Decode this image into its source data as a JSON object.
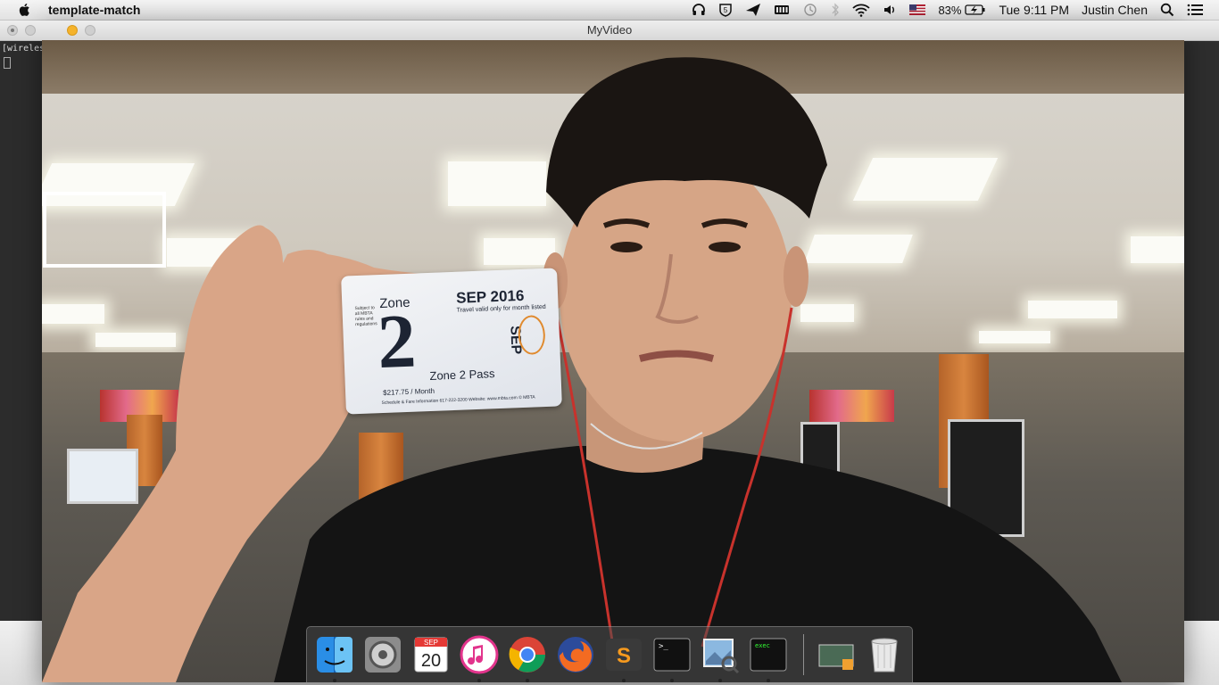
{
  "menubar": {
    "app_name": "template-match",
    "battery_percent": "83%",
    "clock": "Tue 9:11 PM",
    "user": "Justin Chen",
    "icons": [
      "apple-icon",
      "headphones-icon",
      "shield-icon",
      "send-icon",
      "keyboard-icon",
      "time-machine-icon",
      "bluetooth-icon",
      "wifi-icon",
      "volume-icon",
      "flag-icon",
      "battery-icon",
      "search-icon",
      "list-icon"
    ]
  },
  "terminal": {
    "visible_text": "[wireles",
    "right_bracket": "]"
  },
  "window": {
    "title": "MyVideo"
  },
  "pass": {
    "zone_word": "Zone",
    "zone_number": "2",
    "month": "SEP 2016",
    "validity": "Travel valid only for month listed",
    "vertical_month": "SEP",
    "name": "Zone 2 Pass",
    "price": "$217.75 / Month",
    "footer": "Schedule & Fare Information 617-222-3200 Website: www.mbta.com © MBTA"
  },
  "dock": {
    "items": [
      {
        "name": "Finder",
        "icon": "finder-icon",
        "running": true
      },
      {
        "name": "System Preferences",
        "icon": "system-preferences-icon",
        "running": false
      },
      {
        "name": "Calendar",
        "icon": "calendar-icon",
        "running": false,
        "month": "SEP",
        "day": "20"
      },
      {
        "name": "iTunes",
        "icon": "itunes-icon",
        "running": true
      },
      {
        "name": "Google Chrome",
        "icon": "chrome-icon",
        "running": true
      },
      {
        "name": "Firefox",
        "icon": "firefox-icon",
        "running": false
      },
      {
        "name": "Sublime Text",
        "icon": "sublime-icon",
        "running": true
      },
      {
        "name": "Terminal",
        "icon": "terminal-icon",
        "running": true
      },
      {
        "name": "Preview",
        "icon": "preview-icon",
        "running": true
      },
      {
        "name": "exec",
        "icon": "exec-icon",
        "running": true,
        "label": "exec"
      },
      {
        "name": "Screen Sharing",
        "icon": "screen-icon",
        "running": false
      },
      {
        "name": "Trash",
        "icon": "trash-icon",
        "running": false
      }
    ]
  },
  "colors": {
    "tracker_box": "#ffffff",
    "traffic_yellow": "#f5b32b",
    "dock_bg": "rgba(80,80,80,0.55)"
  }
}
